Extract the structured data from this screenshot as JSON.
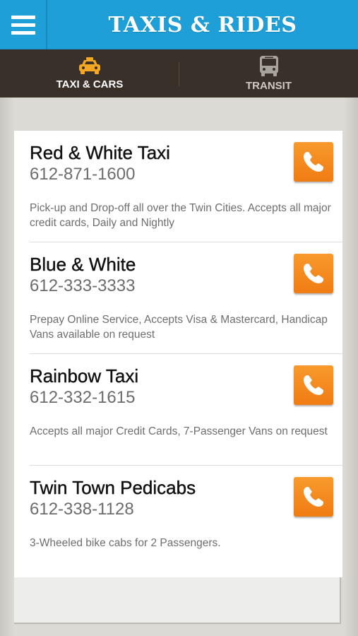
{
  "header": {
    "title": "TAXIS & RIDES",
    "menu_icon": "hamburger-menu-icon"
  },
  "tabs": [
    {
      "label": "TAXI & CARS",
      "icon": "taxi-icon",
      "active": true
    },
    {
      "label": "TRANSIT",
      "icon": "bus-icon",
      "active": false
    }
  ],
  "colors": {
    "header": "#1e9fd8",
    "tabbar": "#3a302a",
    "accent": "#f58a1f",
    "call_button": "#f58a1f"
  },
  "companies": [
    {
      "name": "Red & White Taxi",
      "phone": "612-871-1600",
      "description": "Pick-up and Drop-off all over the Twin Cities. Accepts all major credit cards, Daily and Nightly"
    },
    {
      "name": "Blue & White",
      "phone": "612-333-3333",
      "description": "Prepay Online Service, Accepts Visa & Mastercard, Handicap Vans available on request"
    },
    {
      "name": "Rainbow Taxi",
      "phone": "612-332-1615",
      "description": "Accepts all major Credit Cards, 7-Passenger Vans on request"
    },
    {
      "name": "Twin Town Pedicabs",
      "phone": "612-338-1128",
      "description": "3-Wheeled bike cabs for 2 Passengers."
    }
  ]
}
